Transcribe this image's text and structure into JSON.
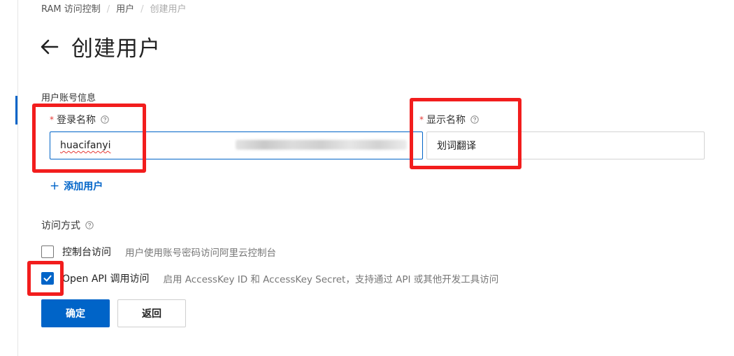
{
  "breadcrumb": {
    "items": [
      "RAM 访问控制",
      "用户",
      "创建用户"
    ],
    "separator": "/"
  },
  "page": {
    "title": "创建用户",
    "back_icon": "arrow-left-icon"
  },
  "form": {
    "section_label": "用户账号信息",
    "login_name": {
      "label": "登录名称",
      "required": "*",
      "value": "huacifanyi",
      "help_icon": "question-circle-icon"
    },
    "display_name": {
      "label": "显示名称",
      "required": "*",
      "value": "划词翻译",
      "help_icon": "question-circle-icon"
    },
    "add_user": {
      "icon": "plus-icon",
      "label": "添加用户"
    }
  },
  "access": {
    "label": "访问方式",
    "help_icon": "question-circle-icon",
    "options": [
      {
        "title": "控制台访问",
        "desc": "用户使用账号密码访问阿里云控制台",
        "checked": false
      },
      {
        "title": "Open API 调用访问",
        "desc": "启用 AccessKey ID 和 AccessKey Secret，支持通过 API 或其他开发工具访问",
        "checked": true
      }
    ]
  },
  "actions": {
    "confirm": "确定",
    "back": "返回"
  },
  "colors": {
    "primary": "#0064c8",
    "annotation_red": "#f21d1d",
    "required": "#e53935"
  }
}
